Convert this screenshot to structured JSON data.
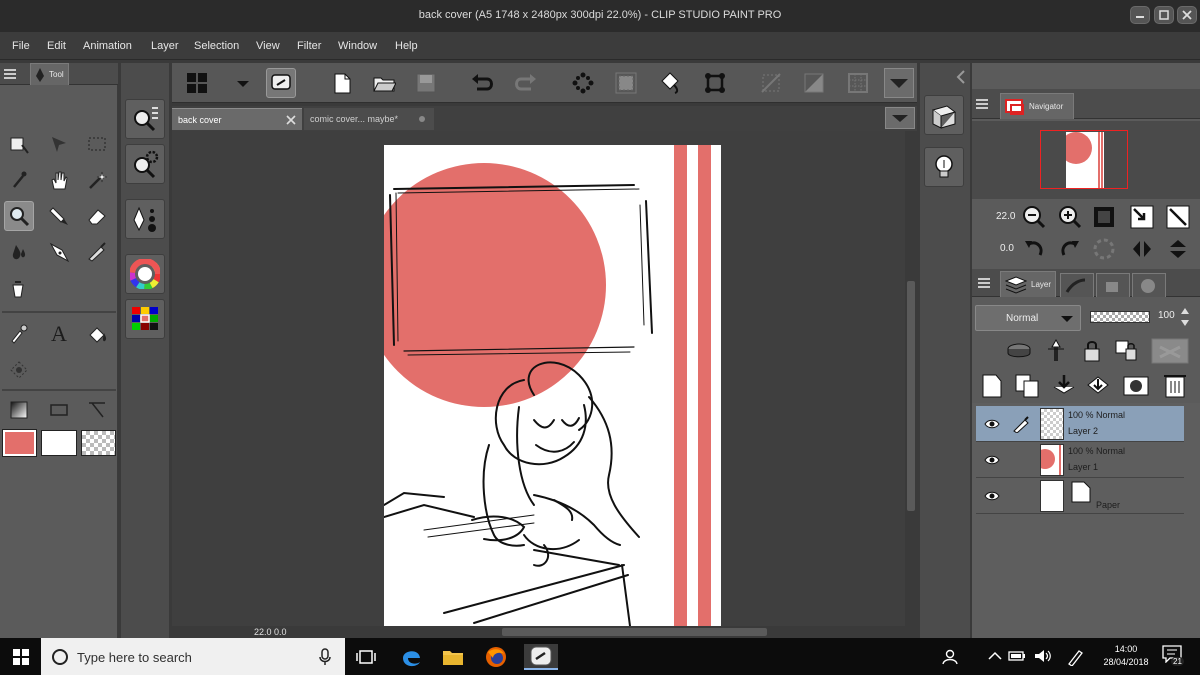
{
  "window": {
    "title": "back cover (A5 1748 x 2480px 300dpi 22.0%)  - CLIP STUDIO PAINT PRO"
  },
  "menu": [
    "File",
    "Edit",
    "Animation",
    "Layer",
    "Selection",
    "View",
    "Filter",
    "Window",
    "Help"
  ],
  "tool_panel": {
    "tab_label": "Tool",
    "tools": [
      "zoom-move-icon",
      "operation-icon",
      "selection-marquee-icon",
      "eyedropper-icon",
      "hand-icon",
      "magic-wand-icon",
      "zoom-tool-icon",
      "pen-icon",
      "eraser-icon",
      "blend-drop-icon",
      "fountain-pen-icon",
      "airbrush-icon",
      "fill-bucket-icon",
      "decoration-icon",
      "text-icon",
      "fill-icon",
      "pattern-icon",
      "gradient-icon",
      "rectangle-icon",
      "ruler-icon"
    ],
    "colors": {
      "main": "#e36f6b",
      "sub": "#ffffff"
    }
  },
  "tabs": [
    {
      "label": "back cover",
      "active": true
    },
    {
      "label": "comic cover... maybe*",
      "active": false
    }
  ],
  "canvas": {
    "accent": "#e36f6b",
    "zoom_readout": "22.0",
    "rotation_readout": "0.0"
  },
  "navigator": {
    "tab_label": "Navigator",
    "zoom_value": "22.0",
    "rotate_value": "0.0"
  },
  "layer_panel": {
    "tab_label": "Layer",
    "blend_mode": "Normal",
    "opacity": "100",
    "layers": [
      {
        "name": "Layer 2",
        "mode": "100 % Normal",
        "selected": true
      },
      {
        "name": "Layer 1",
        "mode": "100 % Normal",
        "selected": false
      },
      {
        "name": "Paper",
        "mode": "",
        "selected": false
      }
    ]
  },
  "taskbar": {
    "search_placeholder": "Type here to search",
    "time": "14:00",
    "date": "28/04/2018",
    "notification_count": "21"
  }
}
